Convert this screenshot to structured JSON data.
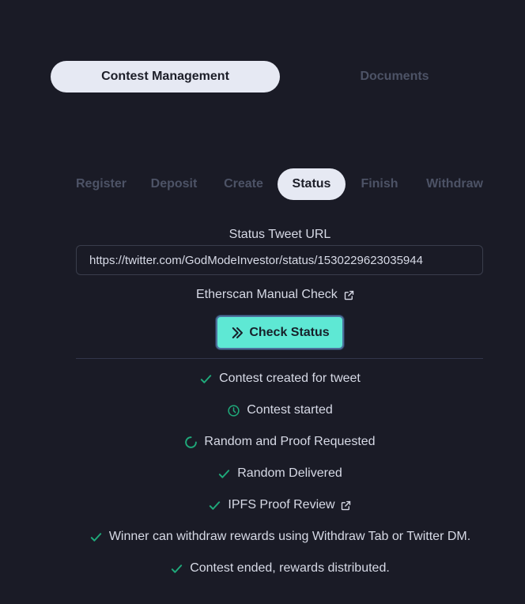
{
  "top_tabs": {
    "active": "Contest Management",
    "inactive": "Documents"
  },
  "sub_tabs": [
    "Register",
    "Deposit",
    "Create",
    "Status",
    "Finish",
    "Withdraw"
  ],
  "active_sub_tab": "Status",
  "form": {
    "url_label": "Status Tweet URL",
    "url_value": "https://twitter.com/GodModeInvestor/status/1530229623035944",
    "etherscan_link": "Etherscan Manual Check",
    "check_button": "Check Status"
  },
  "statuses": [
    {
      "icon": "check-icon",
      "text": "Contest created for tweet"
    },
    {
      "icon": "clock-icon",
      "text": "Contest started"
    },
    {
      "icon": "spinner-icon",
      "text": "Random and Proof Requested"
    },
    {
      "icon": "check-icon",
      "text": "Random Delivered"
    },
    {
      "icon": "check-icon",
      "text": "IPFS Proof Review",
      "external": true
    },
    {
      "icon": "check-icon",
      "text": "Winner can withdraw rewards using Withdraw Tab or Twitter DM."
    },
    {
      "icon": "check-icon",
      "text": "Contest ended, rewards distributed."
    }
  ],
  "colors": {
    "background": "#1a1b26",
    "accent": "#5ee8d4",
    "success": "#1fa97a"
  }
}
